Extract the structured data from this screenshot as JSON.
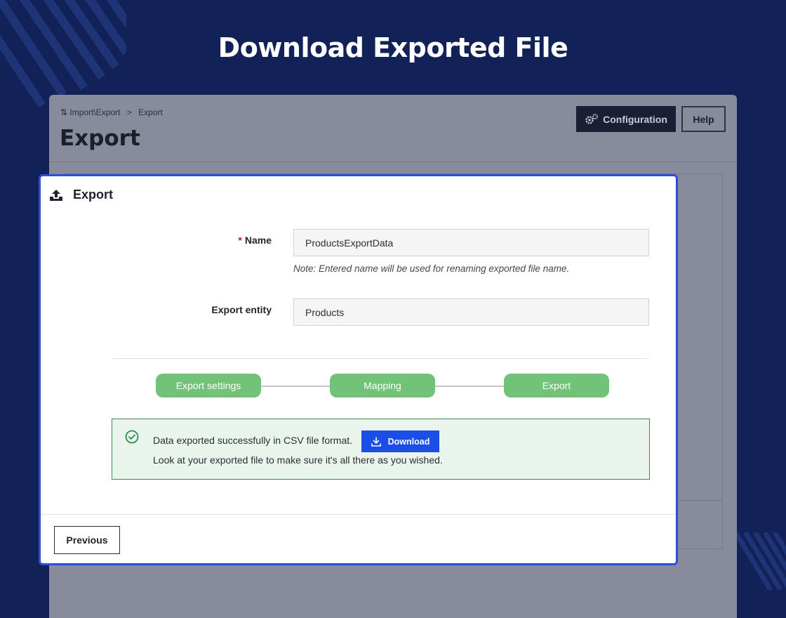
{
  "banner": {
    "title": "Download Exported File"
  },
  "background_page": {
    "breadcrumb": {
      "parent": "Import\\Export",
      "separator": ">",
      "current": "Export"
    },
    "title": "Export",
    "buttons": {
      "configuration": "Configuration",
      "help": "Help"
    }
  },
  "modal": {
    "title": "Export",
    "title_icon": "upload-icon",
    "form": {
      "name_label": "Name",
      "name_required_mark": "*",
      "name_value": "ProductsExportData",
      "name_note": "Note: Entered name will be used for renaming exported file name.",
      "entity_label": "Export entity",
      "entity_value": "Products"
    },
    "steps": [
      "Export settings",
      "Mapping",
      "Export"
    ],
    "alert": {
      "icon": "check-circle-icon",
      "message": "Data exported successfully in CSV file format.",
      "download_label": "Download",
      "hint": "Look at your exported file to make sure it's all there as you wished."
    },
    "footer": {
      "previous_label": "Previous"
    }
  },
  "colors": {
    "background": "#122157",
    "modal_border": "#2d4fd7",
    "step_complete": "#73c27a",
    "download_button": "#1a4ee6",
    "alert_background": "#e9f5ec",
    "alert_border": "#3e8a52"
  }
}
